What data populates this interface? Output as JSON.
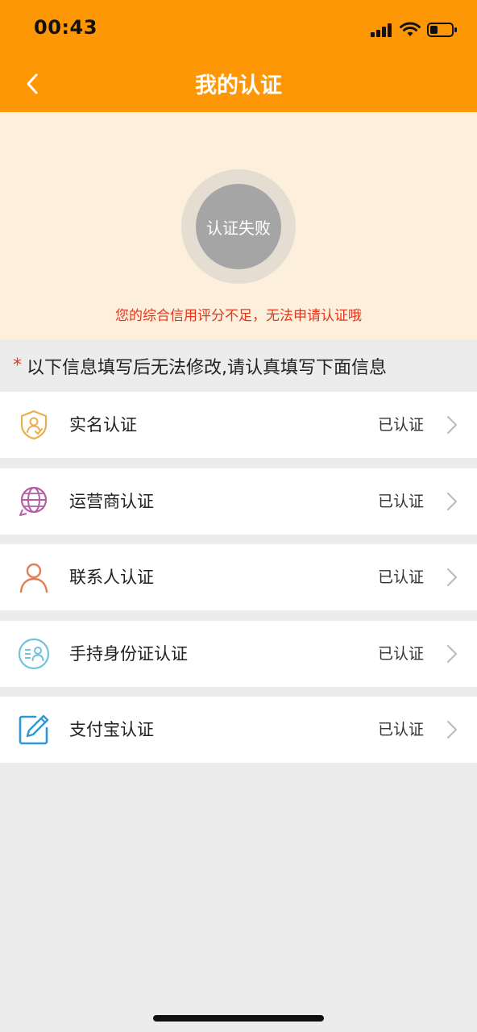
{
  "status_bar": {
    "time": "00:43"
  },
  "header": {
    "title": "我的认证"
  },
  "hero": {
    "result_label": "认证失败",
    "message": "您的综合信用评分不足，无法申请认证哦"
  },
  "notice": {
    "asterisk": "*",
    "text": "以下信息填写后无法修改,请认真填写下面信息"
  },
  "items": [
    {
      "label": "实名认证",
      "status": "已认证",
      "icon": "shield-user-icon"
    },
    {
      "label": "运营商认证",
      "status": "已认证",
      "icon": "globe-icon"
    },
    {
      "label": "联系人认证",
      "status": "已认证",
      "icon": "person-icon"
    },
    {
      "label": "手持身份证认证",
      "status": "已认证",
      "icon": "id-card-icon"
    },
    {
      "label": "支付宝认证",
      "status": "已认证",
      "icon": "edit-icon"
    }
  ],
  "colors": {
    "brand": "#fe9705",
    "warning": "#e0391f",
    "hero_bg": "#fcefdc"
  }
}
